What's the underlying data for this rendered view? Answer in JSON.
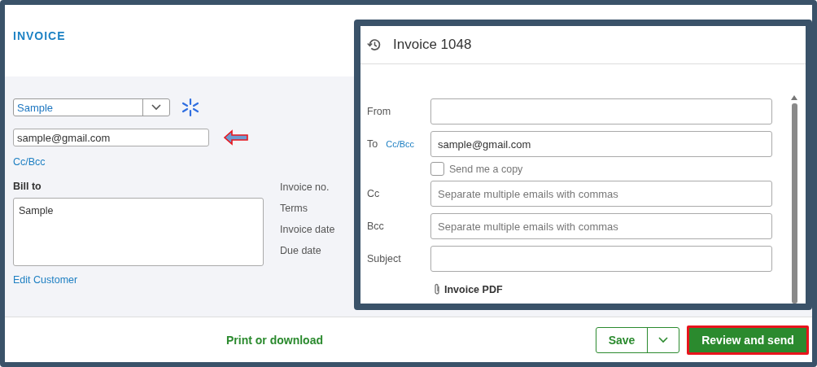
{
  "page": {
    "title": "INVOICE"
  },
  "customer": {
    "value": "Sample",
    "email": "sample@gmail.com",
    "cc_bcc_link": "Cc/Bcc",
    "bill_to_label": "Bill to",
    "bill_to": "Sample",
    "edit_link": "Edit Customer"
  },
  "invoice_fields": [
    "Invoice no.",
    "Terms",
    "Invoice date",
    "Due date"
  ],
  "email_panel": {
    "title": "Invoice 1048",
    "rows": [
      {
        "kind": "field",
        "label": "From"
      },
      {
        "kind": "field",
        "label": "To",
        "link": "Cc/Bcc",
        "value": "sample@gmail.com"
      },
      {
        "kind": "checkbox",
        "label": "Send me a copy",
        "checked": false
      },
      {
        "kind": "field",
        "label": "Cc",
        "placeholder": "Separate multiple emails with commas"
      },
      {
        "kind": "field",
        "label": "Bcc",
        "placeholder": "Separate multiple emails with commas"
      },
      {
        "kind": "field",
        "label": "Subject"
      },
      {
        "kind": "attachment",
        "label": "Invoice PDF"
      }
    ]
  },
  "footer": {
    "print": "Print or download",
    "save": "Save",
    "send": "Review and send"
  }
}
